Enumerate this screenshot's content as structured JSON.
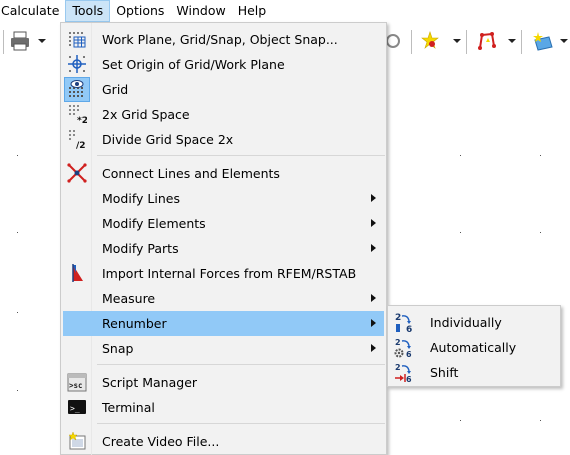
{
  "menubar": {
    "items": [
      "Calculate",
      "Tools",
      "Options",
      "Window",
      "Help"
    ],
    "active_index": 1
  },
  "tools_menu": {
    "items": [
      {
        "label": "Work Plane, Grid/Snap, Object Snap...",
        "icon": "work-plane-icon",
        "submenu": false
      },
      {
        "label": "Set Origin of Grid/Work Plane",
        "icon": "set-origin-icon",
        "submenu": false
      },
      {
        "label": "Grid",
        "icon": "grid-icon",
        "submenu": false,
        "checked": true
      },
      {
        "label": "2x Grid Space",
        "icon": "grid-multiply-icon",
        "submenu": false
      },
      {
        "label": "Divide Grid Space 2x",
        "icon": "grid-divide-icon",
        "submenu": false
      },
      {
        "label": "Connect Lines and Elements",
        "icon": "connect-lines-icon",
        "submenu": false
      },
      {
        "label": "Modify Lines",
        "submenu": true
      },
      {
        "label": "Modify Elements",
        "submenu": true
      },
      {
        "label": "Modify Parts",
        "submenu": true
      },
      {
        "label": "Import Internal Forces from RFEM/RSTAB",
        "icon": "import-forces-icon",
        "submenu": false
      },
      {
        "label": "Measure",
        "submenu": true
      },
      {
        "label": "Renumber",
        "submenu": true,
        "highlighted": true
      },
      {
        "label": "Snap",
        "submenu": true
      },
      {
        "label": "Script Manager",
        "icon": "script-manager-icon",
        "submenu": false
      },
      {
        "label": "Terminal",
        "icon": "terminal-icon",
        "submenu": false
      },
      {
        "label": "Create Video File...",
        "icon": "video-file-icon",
        "submenu": false
      }
    ]
  },
  "renumber_submenu": {
    "items": [
      {
        "label": "Individually",
        "icon": "renumber-individually-icon"
      },
      {
        "label": "Automatically",
        "icon": "renumber-automatically-icon"
      },
      {
        "label": "Shift",
        "icon": "renumber-shift-icon"
      }
    ],
    "icon_numbers": {
      "top": "2",
      "bottom": "6"
    }
  },
  "icons": {
    "script_text": ">sc",
    "terminal_text": ">_"
  },
  "colors": {
    "menu_bg": "#f2f2f2",
    "highlight": "#91c9f7",
    "menubar_active": "#cce4f7",
    "accent_red": "#d0201f",
    "accent_blue": "#1f5fbf"
  }
}
